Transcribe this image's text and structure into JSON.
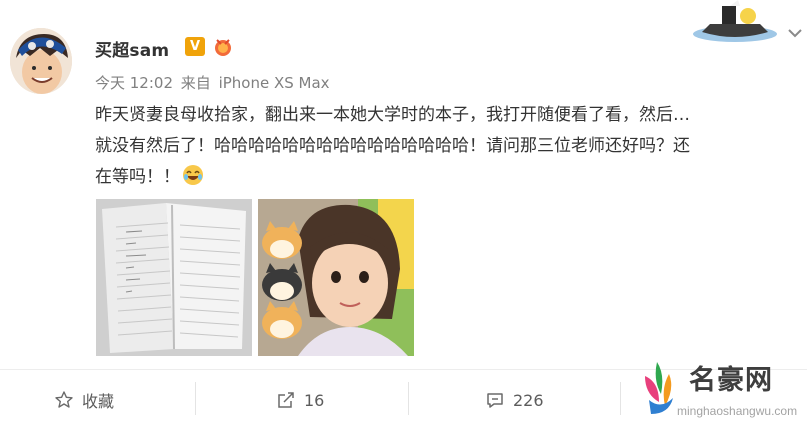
{
  "post": {
    "username": "买超sam",
    "vip_badge": "V",
    "meta": {
      "time": "今天 12:02",
      "source_prefix": "来自",
      "device": "iPhone XS Max"
    },
    "text_lines": [
      "昨天贤妻良母收拾家，翻出来一本她大学时的本子，我打开随便看了看，然后…",
      "就没有然后了！哈哈哈哈哈哈哈哈哈哈哈哈哈哈哈！请问那三位老师还好吗？还",
      "在等吗！！"
    ],
    "images": [
      "notebook-photo",
      "child-with-stickers-photo"
    ]
  },
  "actions": {
    "favorite_label": "收藏",
    "repost_count": "16",
    "comment_count": "226"
  },
  "watermark": {
    "brand": "名豪网",
    "url": "minghaoshangwu.com"
  },
  "colors": {
    "text": "#333333",
    "meta": "#808080",
    "vip": "#f0a30a",
    "action_text": "#5c5c5c"
  }
}
